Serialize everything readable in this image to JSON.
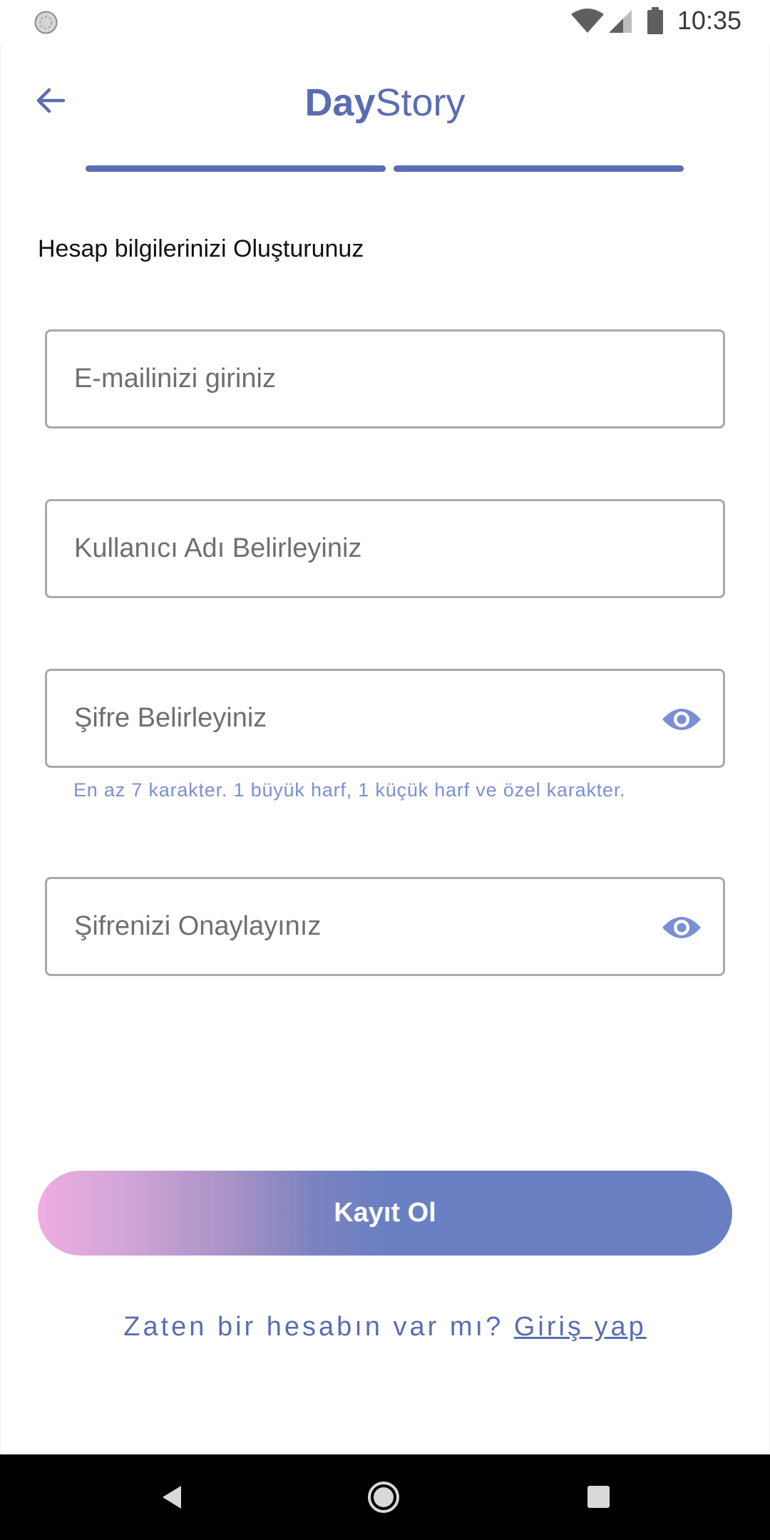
{
  "status_bar": {
    "time": "10:35",
    "icons": [
      "loading-circle-icon",
      "wifi-icon",
      "cellular-signal-icon",
      "battery-icon"
    ]
  },
  "header": {
    "title_bold": "Day",
    "title_regular": "Story",
    "back_icon": "arrow-left-icon",
    "progress_steps_total": 2,
    "progress_steps_completed": 2
  },
  "form": {
    "heading": "Hesap bilgilerinizi Oluşturunuz",
    "email": {
      "placeholder": "E-mailinizi giriniz",
      "value": ""
    },
    "username": {
      "placeholder": "Kullanıcı Adı Belirleyiniz",
      "value": ""
    },
    "password": {
      "placeholder": "Şifre Belirleyiniz",
      "value": "",
      "visibility_icon": "eye-icon",
      "helper": "En az 7 karakter. 1 büyük harf, 1 küçük harf ve özel karakter."
    },
    "confirm_password": {
      "placeholder": "Şifrenizi Onaylayınız",
      "value": "",
      "visibility_icon": "eye-icon"
    },
    "submit_label": "Kayıt Ol"
  },
  "footer": {
    "prompt": "Zaten bir hesabın var mı? ",
    "login_link": "Giriş yap"
  },
  "colors": {
    "brand": "#5b6db1",
    "helper_text": "#7b8fd6",
    "eye_icon": "#7b8fd6",
    "gradient_start": "#f0ace0",
    "gradient_end": "#6a80c3",
    "field_border": "#a9a9a9"
  },
  "nav_bar": {
    "icons": [
      "nav-back-icon",
      "nav-home-icon",
      "nav-recent-apps-icon"
    ]
  }
}
